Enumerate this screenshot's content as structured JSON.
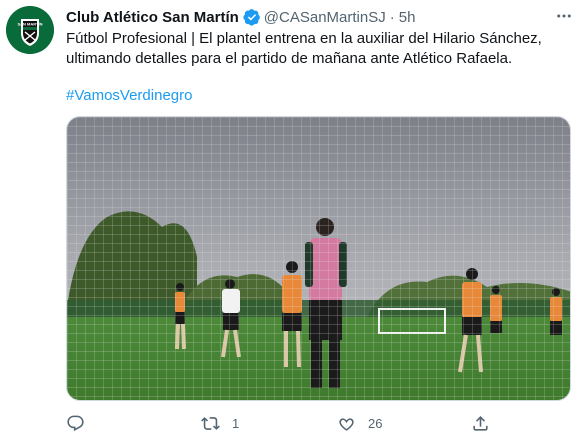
{
  "tweet": {
    "author_name": "Club Atlético San Martín",
    "handle": "@CASanMartinSJ",
    "separator": "·",
    "time": "5h",
    "text_line1": "Fútbol Profesional | El plantel entrena en la auxiliar del Hilario Sánchez,",
    "text_line2": "ultimando detalles para el partido de mañana ante Atlético Rafaela.",
    "hashtag": "#VamosVerdinegro",
    "avatar_text": "SAN MARTÍN"
  },
  "actions": {
    "replies": "",
    "retweets": "1",
    "likes": "26"
  },
  "icons": {
    "verified": "verified-badge-icon",
    "more": "more-options-icon",
    "reply": "reply-icon",
    "retweet": "retweet-icon",
    "like": "heart-icon",
    "share": "share-icon"
  },
  "colors": {
    "text": "#0f1419",
    "muted": "#536471",
    "link": "#1d9bf0",
    "avatar_green": "#0a6b3a"
  }
}
